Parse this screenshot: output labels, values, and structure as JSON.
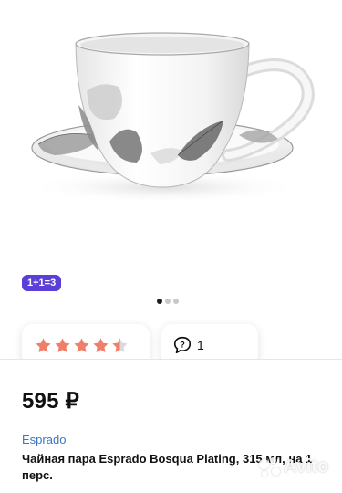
{
  "badge": {
    "label": "1+1=3",
    "color": "#5b3fd6"
  },
  "gallery": {
    "dot_count": 3,
    "active_index": 0
  },
  "rating": {
    "stars": 4.5,
    "max": 5,
    "star_color": "#ef7f6b",
    "empty_color": "#d9d9d9"
  },
  "reviews": {
    "icon": "speech-bubble-question-icon",
    "count": "1"
  },
  "price": {
    "text": "595 ₽"
  },
  "seller": {
    "name": "Esprado"
  },
  "product": {
    "title": "Чайная пара Esprado Bosqua Plating, 315 мл, на 1 перс."
  },
  "watermark": {
    "text": "Avito"
  }
}
